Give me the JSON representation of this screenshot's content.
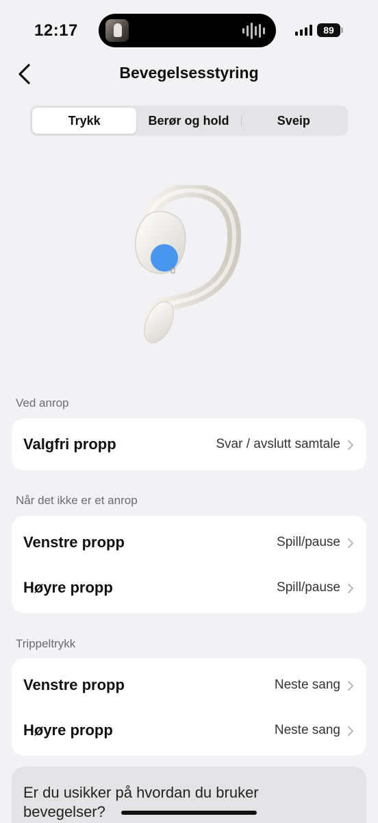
{
  "status_bar": {
    "time": "12:17",
    "battery": "89"
  },
  "header": {
    "title": "Bevegelsesstyring"
  },
  "tabs": [
    {
      "label": "Trykk",
      "active": true
    },
    {
      "label": "Berør og hold",
      "active": false
    },
    {
      "label": "Sveip",
      "active": false
    }
  ],
  "sections": {
    "call": {
      "header": "Ved anrop",
      "rows": [
        {
          "label": "Valgfri propp",
          "value": "Svar / avslutt samtale"
        }
      ]
    },
    "no_call": {
      "header": "Når det ikke er et anrop",
      "rows": [
        {
          "label": "Venstre propp",
          "value": "Spill/pause"
        },
        {
          "label": "Høyre propp",
          "value": "Spill/pause"
        }
      ]
    },
    "triple": {
      "header": "Trippeltrykk",
      "rows": [
        {
          "label": "Venstre propp",
          "value": "Neste sang"
        },
        {
          "label": "Høyre propp",
          "value": "Neste sang"
        }
      ]
    }
  },
  "help": {
    "text": "Er du usikker på hvordan du bruker bevegelser?"
  },
  "colors": {
    "background": "#f2f2f4",
    "accent_tap_dot": "#3b8ff0"
  }
}
